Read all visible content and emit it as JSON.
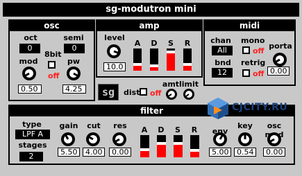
{
  "app": {
    "title": "sg-modutron mini"
  },
  "osc": {
    "title": "osc",
    "oct_label": "oct",
    "oct_value": "0",
    "semi_label": "semi",
    "semi_value": "0",
    "mod_label": "mod",
    "mod_value": "0.50",
    "bit_label": "8bit",
    "bit_state": "off",
    "pw_label": "pw",
    "pw_value": "4.25"
  },
  "amp": {
    "title": "amp",
    "level_label": "level",
    "level_value": "10.0",
    "adsr_labels": [
      "A",
      "D",
      "S",
      "R"
    ]
  },
  "midi": {
    "title": "midi",
    "chan_label": "chan",
    "chan_value": "All",
    "mono_label": "mono",
    "mono_state": "off",
    "porta_label": "porta",
    "porta_value": "0.00",
    "bnd_label": "bnd rng",
    "bnd_value": "12",
    "retrig_label": "retrig",
    "retrig_state": "off"
  },
  "middle": {
    "logo": "sg",
    "dist_label": "dist",
    "dist_state": "off",
    "amt_label": "amt",
    "limit_label": "limit"
  },
  "filter": {
    "title": "filter",
    "type_label": "type",
    "type_value": "LPF A",
    "stages_label": "stages",
    "stages_value": "2",
    "gain_label": "gain",
    "gain_value": "5.50",
    "cut_label": "cut",
    "cut_value": "4.00",
    "res_label": "res",
    "res_value": "0.00",
    "adsr_labels": [
      "A",
      "D",
      "S",
      "R"
    ],
    "env_label": "env",
    "env_value": "5.00",
    "key_label": "key",
    "key_value": "0.54",
    "oscmod_label": "osc mod",
    "oscmod_value": "0.00"
  },
  "watermark": {
    "text": "CJCITY.RU"
  }
}
